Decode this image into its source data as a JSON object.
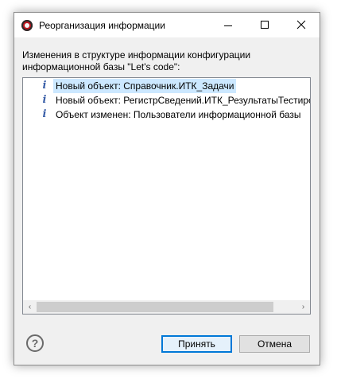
{
  "window": {
    "title": "Реорганизация информации",
    "app_icon": "app-logo-icon"
  },
  "titlebar_buttons": [
    "minimize-icon",
    "maximize-icon",
    "close-icon"
  ],
  "message": {
    "line1": "Изменения в структуре информации конфигурации",
    "line2": "информационной базы \"Let's code\":"
  },
  "changes": [
    {
      "icon": "info-icon",
      "glyph": "i",
      "text": "Новый объект: Справочник.ИТК_Задачи",
      "selected": true
    },
    {
      "icon": "info-icon",
      "glyph": "i",
      "text": "Новый объект: РегистрСведений.ИТК_РезультатыТестиров",
      "selected": false
    },
    {
      "icon": "info-icon",
      "glyph": "i",
      "text": "Объект изменен: Пользователи информационной базы",
      "selected": false
    }
  ],
  "scrollbar": {
    "left_arrow": "‹",
    "right_arrow": "›",
    "thumb_fraction": 0.91
  },
  "help": {
    "icon": "help-icon",
    "glyph": "?"
  },
  "buttons": {
    "ok_label": "Принять",
    "cancel_label": "Отмена"
  },
  "colors": {
    "accent": "#0078d7",
    "selection": "#cce8ff",
    "info_icon": "#3a5fa8"
  }
}
